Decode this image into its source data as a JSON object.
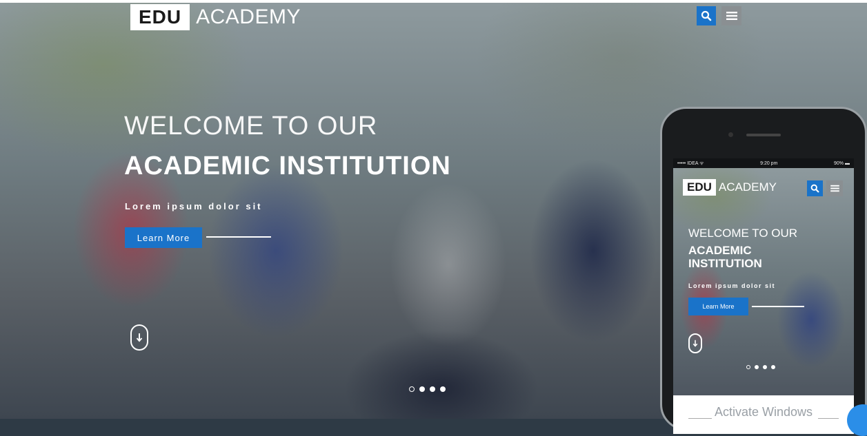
{
  "header": {
    "logo_box": "EDU",
    "logo_text": "ACADEMY",
    "search_icon": "search-icon",
    "menu_icon": "hamburger-menu-icon"
  },
  "hero": {
    "welcome": "WELCOME TO OUR",
    "headline": "ACADEMIC INSTITUTION",
    "subtitle": "Lorem ipsum dolor sit",
    "button_label": "Learn More",
    "scroll_icon": "scroll-down-icon",
    "slides_count": 4,
    "active_slide": 1
  },
  "phone": {
    "status_carrier": "••••• IDEA ᯤ",
    "status_time": "9:20 pm",
    "status_battery": "90% ▬",
    "logo_box": "EDU",
    "logo_text": "ACADEMY",
    "welcome": "WELCOME TO OUR",
    "headline": "ACADEMIC INSTITUTION",
    "subtitle": "Lorem ipsum dolor sit",
    "button_label": "Learn More",
    "watermark": "Activate Windows"
  },
  "colors": {
    "accent": "#1a73c9",
    "menu_button": "#8a8f92",
    "text_light": "#ffffff"
  }
}
